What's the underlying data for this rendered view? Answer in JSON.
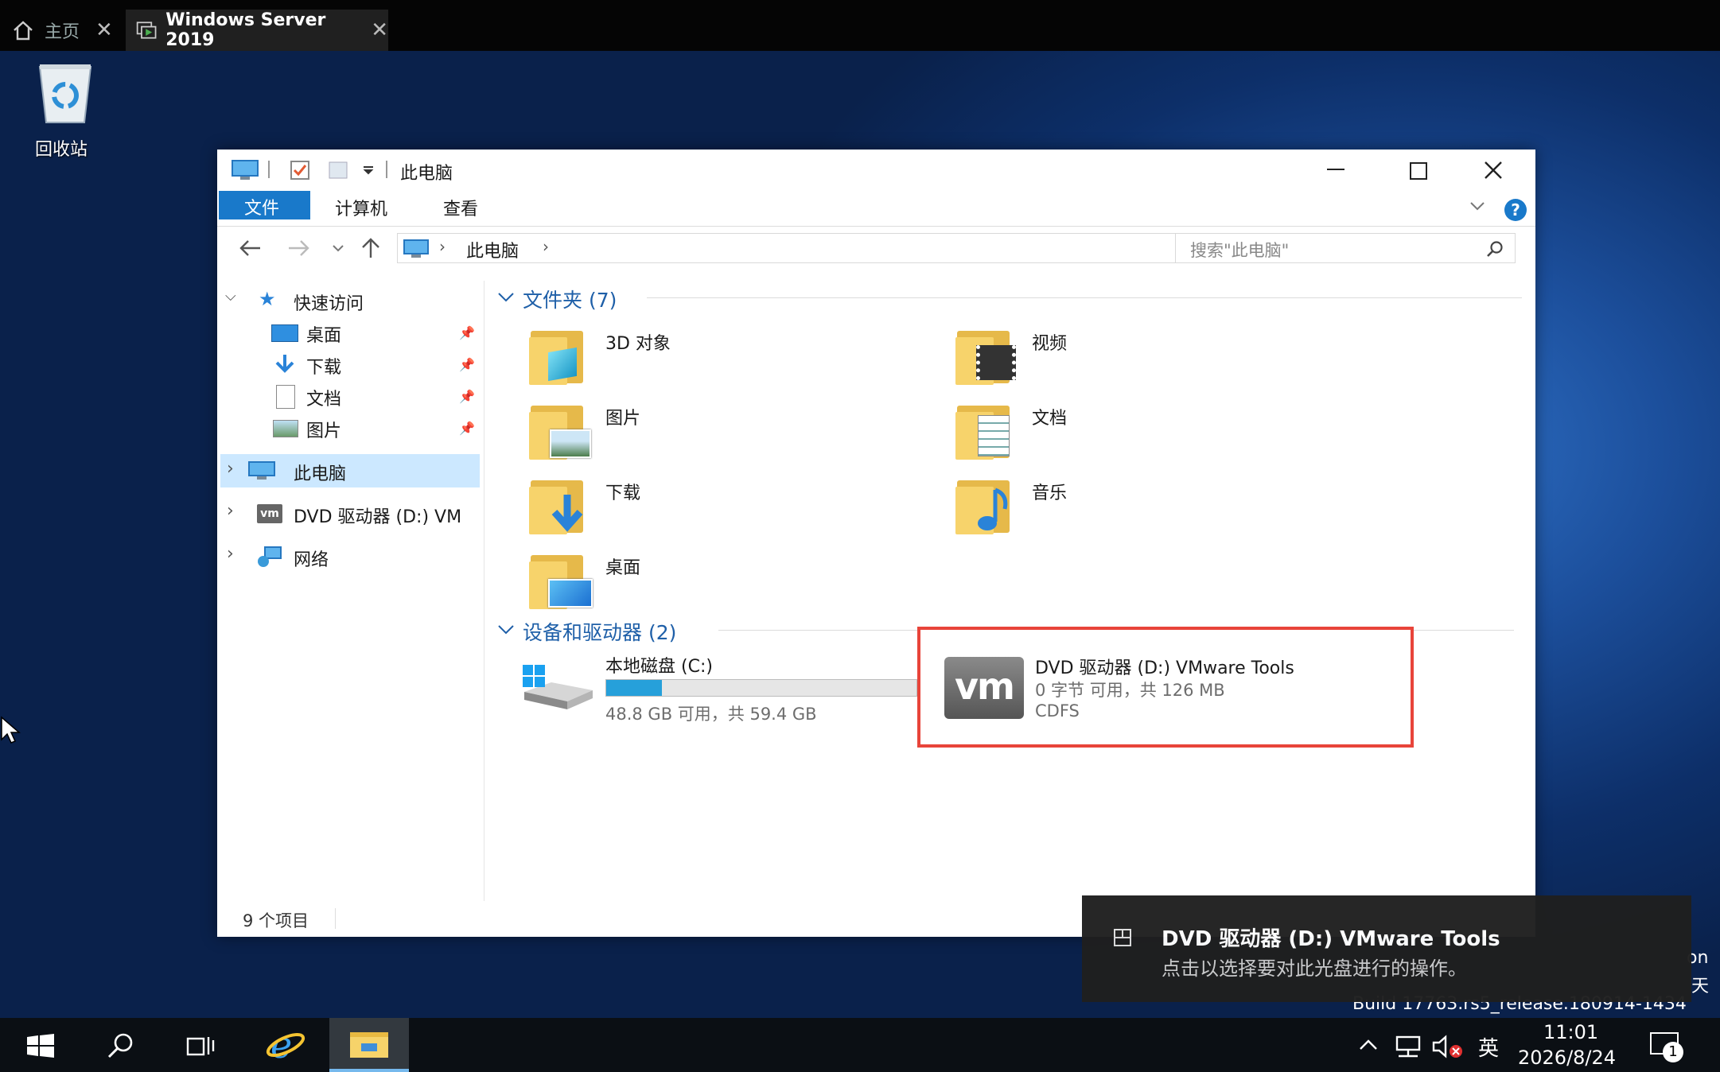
{
  "vm_tabs": [
    {
      "label": "主页"
    },
    {
      "label": "Windows Server 2019"
    }
  ],
  "desktop": {
    "recycle_bin_label": "回收站",
    "build_text": "Build 17763.rs5_release.180914-1434",
    "edge_text_1": "on",
    "edge_text_2": "天"
  },
  "explorer": {
    "title": "此电脑",
    "ribbon_tabs": [
      "文件",
      "计算机",
      "查看"
    ],
    "address": {
      "segment": "此电脑"
    },
    "search": {
      "placeholder": "搜索\"此电脑\""
    },
    "nav": {
      "quick_access": "快速访问",
      "quick_items": [
        "桌面",
        "下载",
        "文档",
        "图片"
      ],
      "this_pc": "此电脑",
      "dvd": "DVD 驱动器 (D:) VM",
      "network": "网络"
    },
    "folders_group": "文件夹 (7)",
    "folders": [
      "3D 对象",
      "视频",
      "图片",
      "文档",
      "下载",
      "音乐",
      "桌面"
    ],
    "devices_group": "设备和驱动器 (2)",
    "drive_c": {
      "name": "本地磁盘 (C:)",
      "space": "48.8 GB 可用，共 59.4 GB",
      "used_fraction": 0.18
    },
    "drive_d": {
      "name": "DVD 驱动器 (D:) VMware Tools",
      "space": "0 字节 可用，共 126 MB",
      "fs": "CDFS",
      "icon_text": "vm"
    },
    "status": "9 个项目"
  },
  "toast": {
    "title": "DVD 驱动器 (D:) VMware Tools",
    "body": "点击以选择要对此光盘进行的操作。"
  },
  "taskbar": {
    "time": "11:01",
    "date": "2026/8/24",
    "ime": "英",
    "notif_count": "1"
  },
  "colors": {
    "accent": "#1979ca",
    "highlight_box": "#e8443a",
    "selection": "#cce8ff"
  }
}
